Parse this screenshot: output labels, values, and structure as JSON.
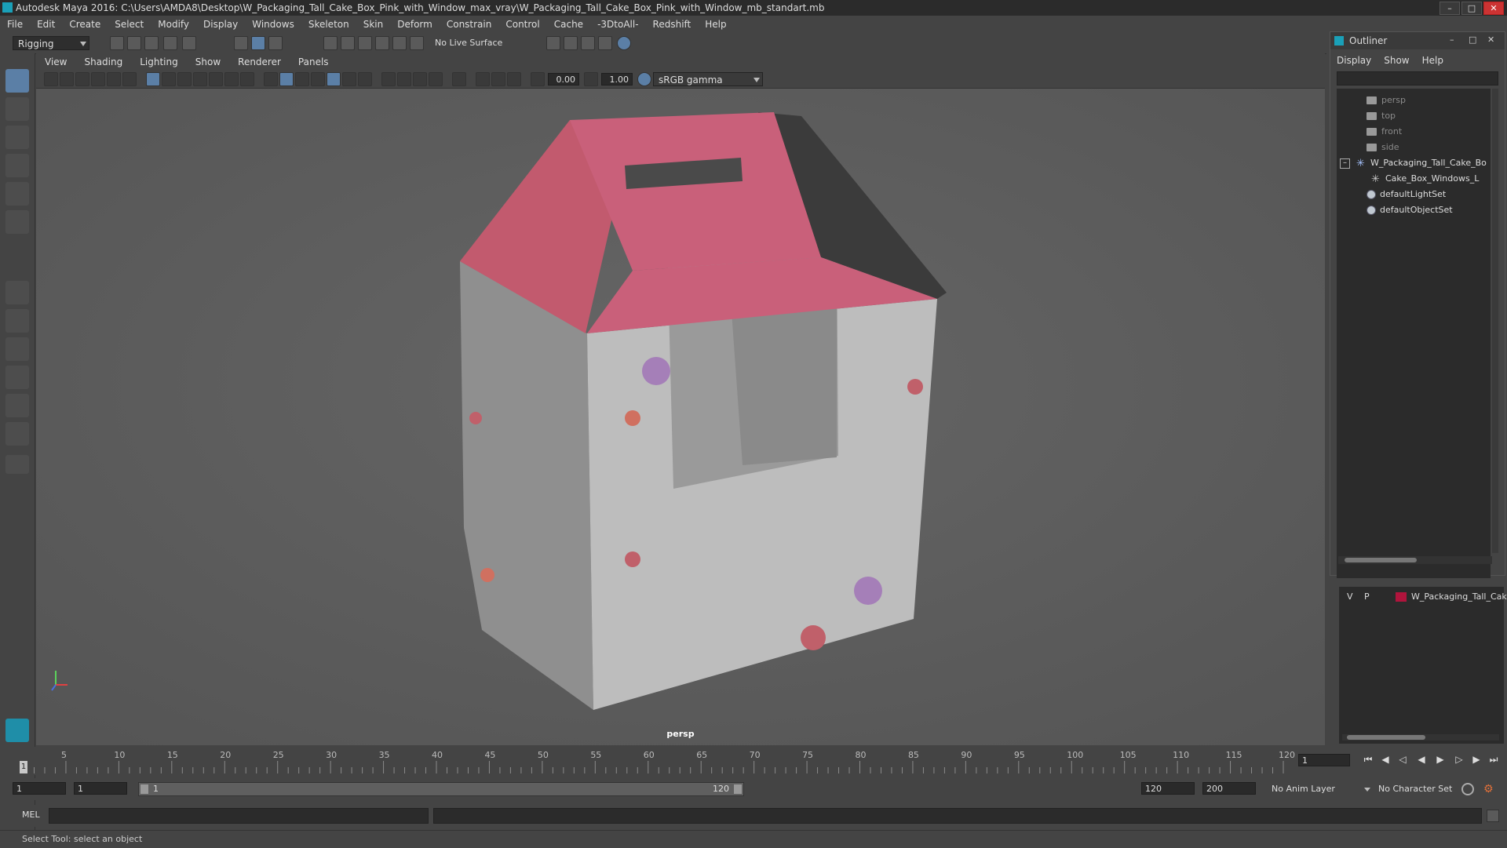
{
  "window": {
    "title": "Autodesk Maya 2016: C:\\Users\\AMDA8\\Desktop\\W_Packaging_Tall_Cake_Box_Pink_with_Window_max_vray\\W_Packaging_Tall_Cake_Box_Pink_with_Window_mb_standart.mb"
  },
  "menubar": [
    "File",
    "Edit",
    "Create",
    "Select",
    "Modify",
    "Display",
    "Windows",
    "Skeleton",
    "Skin",
    "Deform",
    "Constrain",
    "Control",
    "Cache",
    "-3DtoAll-",
    "Redshift",
    "Help"
  ],
  "shelf": {
    "mode": "Rigging",
    "live_surface": "No Live Surface"
  },
  "viewport": {
    "menus": [
      "View",
      "Shading",
      "Lighting",
      "Show",
      "Renderer",
      "Panels"
    ],
    "exposure": "0.00",
    "gamma": "1.00",
    "color_space": "sRGB gamma",
    "camera_label": "persp"
  },
  "outliner": {
    "title": "Outliner",
    "menus": [
      "Display",
      "Show",
      "Help"
    ],
    "items": [
      {
        "label": "persp"
      },
      {
        "label": "top"
      },
      {
        "label": "front"
      },
      {
        "label": "side"
      },
      {
        "label": "W_Packaging_Tall_Cake_Bo"
      },
      {
        "label": "Cake_Box_Windows_L"
      },
      {
        "label": "defaultLightSet"
      },
      {
        "label": "defaultObjectSet"
      }
    ]
  },
  "layers": {
    "v": "V",
    "p": "P",
    "name": "W_Packaging_Tall_Cak",
    "color": "#b0143c"
  },
  "timeline": {
    "current_frame": "1",
    "ticks": [
      "5",
      "10",
      "15",
      "20",
      "25",
      "30",
      "35",
      "40",
      "45",
      "50",
      "55",
      "60",
      "65",
      "70",
      "75",
      "80",
      "85",
      "90",
      "95",
      "100",
      "105",
      "110",
      "115",
      "120"
    ]
  },
  "range": {
    "start": "1",
    "playback_start": "1",
    "slider_start": "1",
    "slider_end": "120",
    "playback_end": "120",
    "end": "200",
    "anim_layer": "No Anim Layer",
    "character_set": "No Character Set"
  },
  "command": {
    "lang": "MEL"
  },
  "help_line": "Select Tool: select an object"
}
